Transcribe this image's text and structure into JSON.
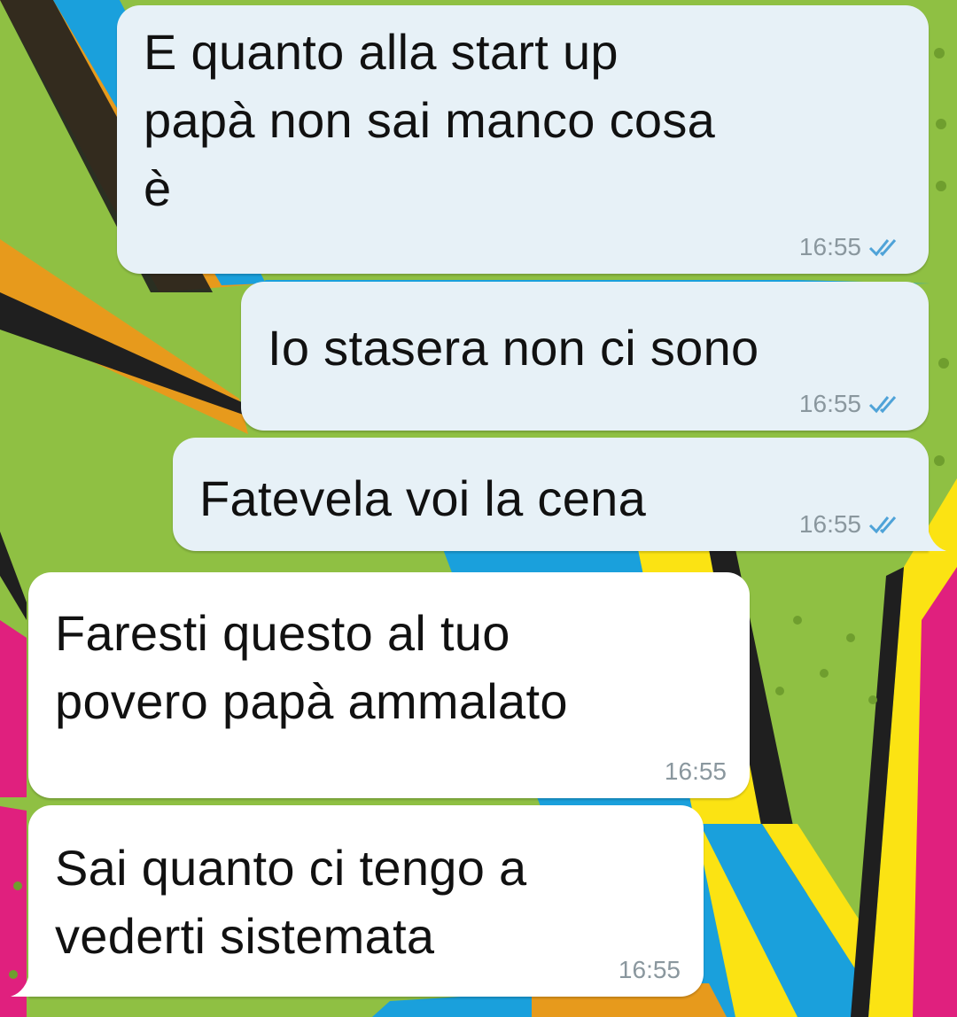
{
  "colors": {
    "outgoing_bubble": "#e7f1f7",
    "incoming_bubble": "#ffffff",
    "timestamp": "#8a979e",
    "read_ticks": "#4fa3d8",
    "wallpaper_green": "#8fc043",
    "wallpaper_blue": "#1aa0dc",
    "wallpaper_orange": "#e79a1c",
    "wallpaper_yellow": "#fbe313",
    "wallpaper_magenta": "#e0207e"
  },
  "messages": [
    {
      "direction": "outgoing",
      "text": "E quanto alla start up\npapà non sai manco cosa\nè",
      "time": "16:55",
      "status_icon": "double-check-read-icon"
    },
    {
      "direction": "outgoing",
      "text": "Io stasera non ci sono",
      "time": "16:55",
      "status_icon": "double-check-read-icon"
    },
    {
      "direction": "outgoing",
      "text": "Fatevela voi la cena",
      "time": "16:55",
      "status_icon": "double-check-read-icon"
    },
    {
      "direction": "incoming",
      "text": "Faresti questo al tuo\npovero papà ammalato",
      "time": "16:55"
    },
    {
      "direction": "incoming",
      "text": "Sai quanto ci tengo a\nvederti sistemata",
      "time": "16:55"
    }
  ]
}
